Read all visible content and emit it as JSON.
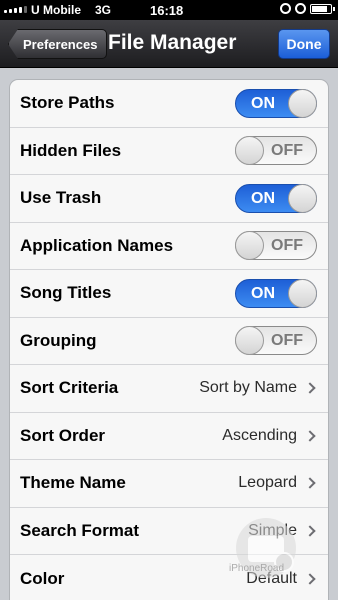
{
  "status_bar": {
    "carrier": "U Mobile",
    "network": "3G",
    "time": "16:18",
    "battery_level": 0.85
  },
  "nav": {
    "back_label": "Preferences",
    "title": "File Manager",
    "done_label": "Done"
  },
  "toggles": [
    {
      "label": "Store Paths",
      "state": "ON"
    },
    {
      "label": "Hidden Files",
      "state": "OFF"
    },
    {
      "label": "Use Trash",
      "state": "ON"
    },
    {
      "label": "Application Names",
      "state": "OFF"
    },
    {
      "label": "Song Titles",
      "state": "ON"
    },
    {
      "label": "Grouping",
      "state": "OFF"
    }
  ],
  "selects": [
    {
      "label": "Sort Criteria",
      "value": "Sort by Name"
    },
    {
      "label": "Sort Order",
      "value": "Ascending"
    },
    {
      "label": "Theme Name",
      "value": "Leopard"
    },
    {
      "label": "Search Format",
      "value": "Simple"
    },
    {
      "label": "Color",
      "value": "Default"
    }
  ],
  "watermark": "iPhoneRoad",
  "colors": {
    "toggle_on": "#2f78e8",
    "done_button": "#2f6fe0",
    "nav_bar": "#2a2a2e"
  },
  "icons": {
    "back": "back-arrow-button",
    "chevron": "chevron-right-icon",
    "lock": "orientation-lock-icon",
    "alarm": "alarm-clock-icon",
    "battery": "battery-icon"
  }
}
